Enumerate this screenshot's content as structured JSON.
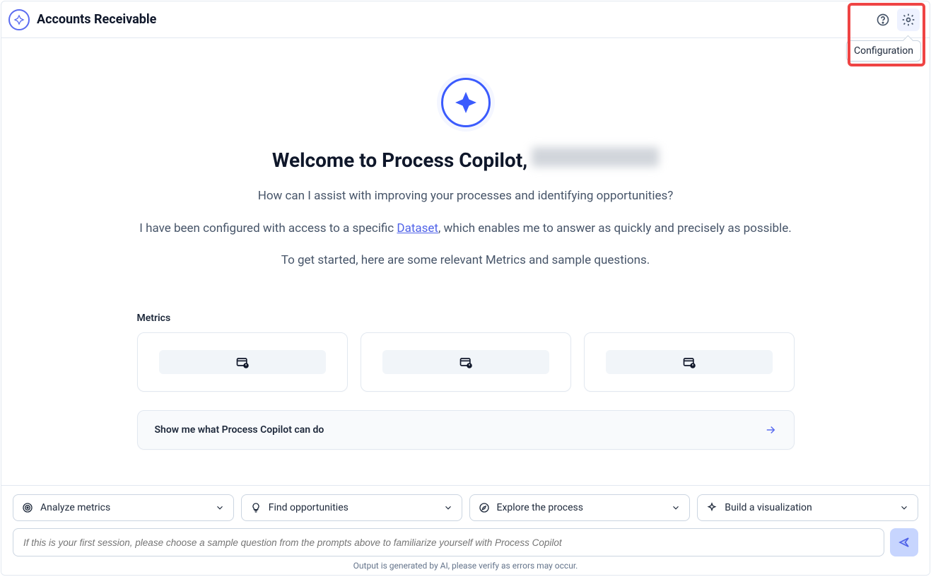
{
  "header": {
    "title": "Accounts Receivable",
    "tooltip": "Configuration"
  },
  "hero": {
    "welcome_prefix": "Welcome to Process Copilot,",
    "line1": "How can I assist with improving your processes and identifying opportunities?",
    "line2_pre": "I have been configured with access to a specific ",
    "line2_link": "Dataset",
    "line2_post": ", which enables me to answer as quickly and precisely as possible.",
    "line3": "To get started, here are some relevant Metrics and sample questions."
  },
  "sections": {
    "metrics_label": "Metrics",
    "demo_label": "Show me what Process Copilot can do"
  },
  "chips": [
    {
      "label": "Analyze metrics"
    },
    {
      "label": "Find opportunities"
    },
    {
      "label": "Explore the process"
    },
    {
      "label": "Build a visualization"
    }
  ],
  "input": {
    "placeholder": "If this is your first session, please choose a sample question from the prompts above to familiarize yourself with Process Copilot"
  },
  "disclaimer": "Output is generated by AI, please verify as errors may occur."
}
